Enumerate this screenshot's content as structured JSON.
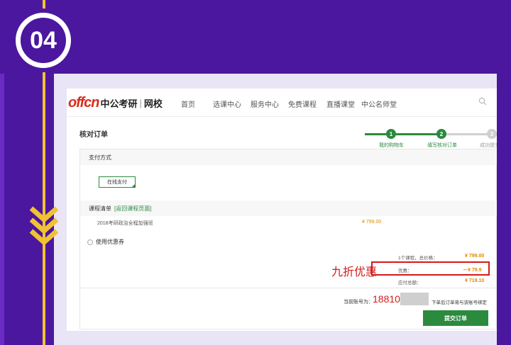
{
  "step": {
    "number": "04"
  },
  "nav": {
    "logo": {
      "brand": "offcn",
      "cn_name": "中公考研",
      "separator": "|",
      "site": "网校"
    },
    "items": [
      {
        "label": "首页"
      },
      {
        "label": "选课中心"
      },
      {
        "label": "服务中心"
      },
      {
        "label": "免费课程"
      },
      {
        "label": "直播课堂"
      },
      {
        "label": "中公名师堂"
      }
    ],
    "search_icon": "search-icon"
  },
  "page": {
    "title": "核对订单",
    "progress": [
      {
        "num": "1",
        "label": "我的购物车",
        "done": true
      },
      {
        "num": "2",
        "label": "填写核对订单",
        "done": true
      },
      {
        "num": "3",
        "label": "成功提交",
        "done": false
      }
    ]
  },
  "payment": {
    "section_title": "支付方式",
    "method_label": "在线支付"
  },
  "course_list": {
    "section_title": "课程清单",
    "back_link": "[返回课程页面]",
    "items": [
      {
        "name": "2018考研政治全程加强班",
        "price": "¥ 799.00"
      }
    ]
  },
  "coupon": {
    "label": "使用优惠券"
  },
  "summary": {
    "rows": [
      {
        "label": "1个课程，总价格：",
        "value": "¥ 799.00"
      },
      {
        "label": "优惠：",
        "value": "－¥ 79.9"
      },
      {
        "label": "应付总额：",
        "value": "¥ 719.10"
      }
    ],
    "callout": "九折优惠"
  },
  "account": {
    "label": "当前账号为：",
    "value": "188101",
    "note": "下单后订单将与该账号绑定"
  },
  "submit": {
    "label": "提交订单"
  },
  "colors": {
    "purple": "#4b179f",
    "accent_yellow": "#f1c232",
    "brand_green": "#2a8a3e",
    "highlight_red": "#d31a1a",
    "price_orange": "#e08a00"
  }
}
